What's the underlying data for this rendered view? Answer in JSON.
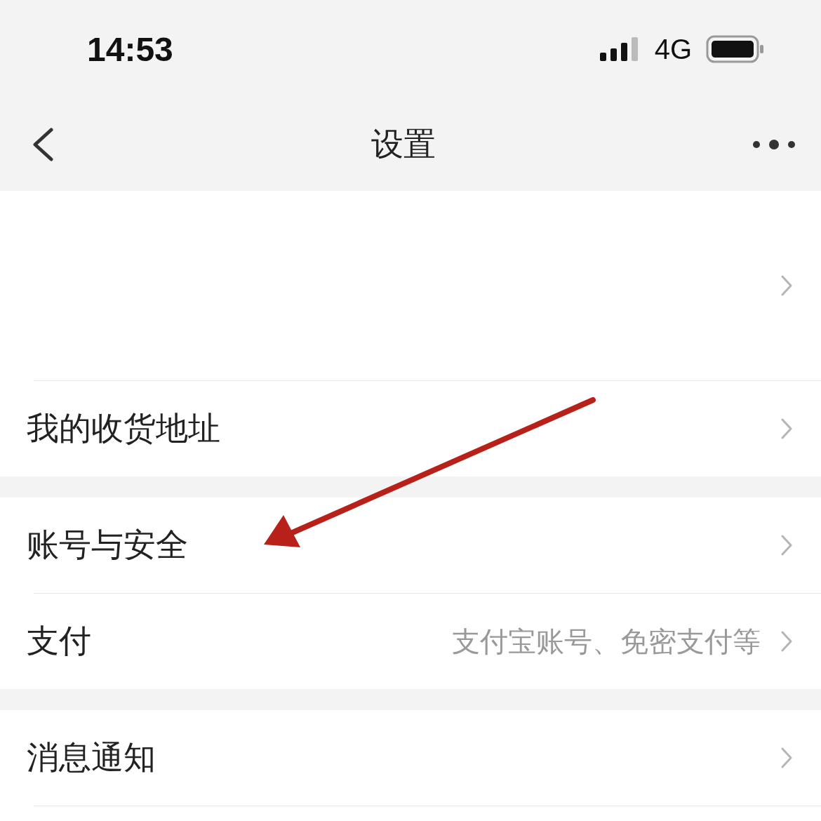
{
  "status_bar": {
    "time": "14:53",
    "network": "4G"
  },
  "nav_bar": {
    "title": "设置"
  },
  "sections": [
    {
      "rows": [
        {
          "kind": "profile"
        },
        {
          "kind": "item",
          "label": "我的收货地址"
        }
      ]
    },
    {
      "rows": [
        {
          "kind": "item",
          "label": "账号与安全"
        },
        {
          "kind": "item",
          "label": "支付",
          "value": "支付宝账号、免密支付等"
        }
      ]
    },
    {
      "rows": [
        {
          "kind": "item",
          "label": "消息通知"
        }
      ]
    }
  ],
  "annotation": {
    "kind": "arrow"
  }
}
